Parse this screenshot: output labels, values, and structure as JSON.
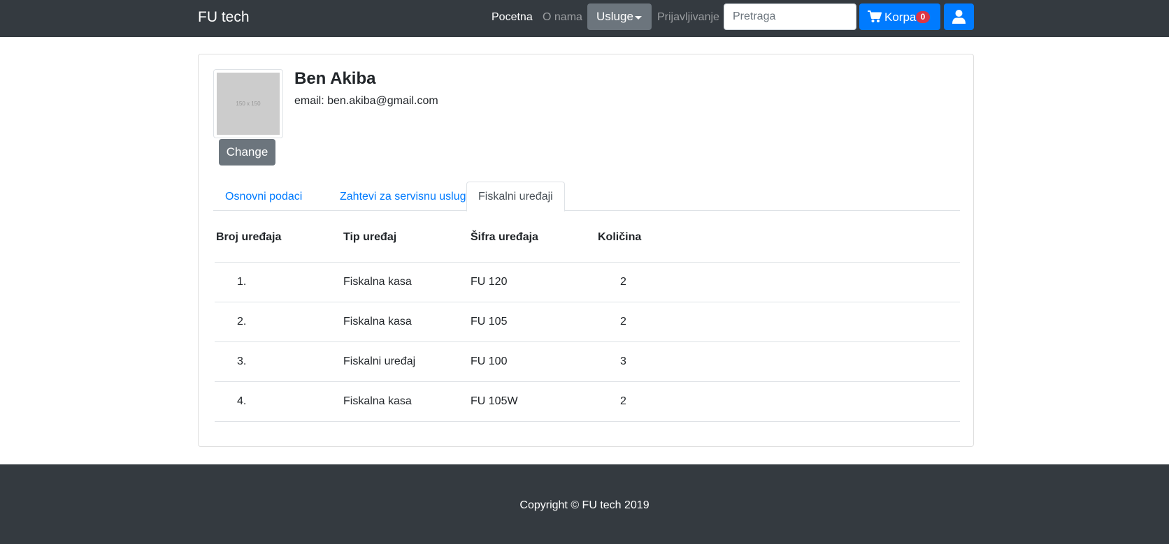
{
  "navbar": {
    "brand": "FU tech",
    "links": [
      "Pocetna",
      "O nama"
    ],
    "dropdown_label": "Usluge",
    "login_label": "Prijavljivanje",
    "search_placeholder": "Pretraga",
    "cart_label": "Korpa",
    "cart_count": "0",
    "cart_icon": "shopping-cart-icon",
    "user_icon": "user-icon"
  },
  "profile": {
    "avatar_text": "150 x 150",
    "change_label": "Change",
    "name": "Ben Akiba",
    "email": "email: ben.akiba@gmail.com"
  },
  "tabs": [
    {
      "label": "Osnovni podaci",
      "active": false
    },
    {
      "label": "Zahtevi za servisnu uslugu",
      "active": false
    },
    {
      "label": "Fiskalni uređaji",
      "active": true
    }
  ],
  "table": {
    "headers": [
      "Broj uređaja",
      "Tip uređaj",
      "Šifra uređaja",
      "Količina"
    ],
    "rows": [
      {
        "num": "1.",
        "type": "Fiskalna kasa",
        "code": "FU 120",
        "qty": "2"
      },
      {
        "num": "2.",
        "type": "Fiskalna kasa",
        "code": "FU 105",
        "qty": "2"
      },
      {
        "num": "3.",
        "type": "Fiskalni uređaj",
        "code": "FU 100",
        "qty": "3"
      },
      {
        "num": "4.",
        "type": "Fiskalna kasa",
        "code": "FU 105W",
        "qty": "2"
      }
    ]
  },
  "footer": {
    "copyright": "Copyright © FU tech 2019"
  },
  "colors": {
    "navbar_bg": "#343a40",
    "primary": "#007bff",
    "secondary": "#6c757d",
    "danger": "#dc3545"
  }
}
